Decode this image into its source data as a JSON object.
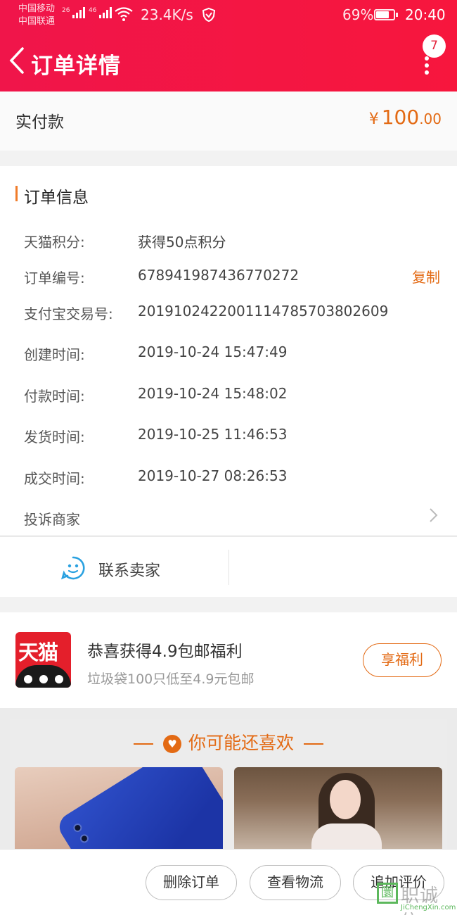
{
  "status_bar": {
    "carrier1": "中国移动",
    "carrier2": "中国联通",
    "sig1": "26",
    "sig2": "46",
    "speed": "23.4K/s",
    "battery": "69%",
    "time": "20:40"
  },
  "header": {
    "title": "订单详情",
    "badge": "7"
  },
  "payment": {
    "label": "实付款",
    "currency": "¥",
    "amount_int": "100",
    "amount_dec": ".00"
  },
  "order_info": {
    "title": "订单信息",
    "rows": [
      {
        "label": "天猫积分:",
        "value": "获得50点积分"
      },
      {
        "label": "订单编号:",
        "value": "678941987436770272"
      },
      {
        "label": "支付宝交易号:",
        "value": "2019102422001114785703802609"
      },
      {
        "label": "创建时间:",
        "value": "2019-10-24 15:47:49"
      },
      {
        "label": "付款时间:",
        "value": "2019-10-24 15:48:02"
      },
      {
        "label": "发货时间:",
        "value": "2019-10-25 11:46:53"
      },
      {
        "label": "成交时间:",
        "value": "2019-10-27 08:26:53"
      }
    ],
    "copy_label": "复制",
    "complaint_label": "投诉商家"
  },
  "contact": {
    "label": "联系卖家"
  },
  "promo": {
    "logo_text": "天猫",
    "title": "恭喜获得4.9包邮福利",
    "subtitle": "垃圾袋100只低至4.9元包邮",
    "button": "享福利"
  },
  "recommend": {
    "title": "你可能还喜欢"
  },
  "actions": {
    "delete": "删除订单",
    "logistics": "查看物流",
    "review": "追加评价"
  },
  "watermark": {
    "box": "圜",
    "cn": "职诚信",
    "en": "JiChengXin.com"
  },
  "colors": {
    "header": "#f0154a",
    "accent": "#e36a14"
  }
}
